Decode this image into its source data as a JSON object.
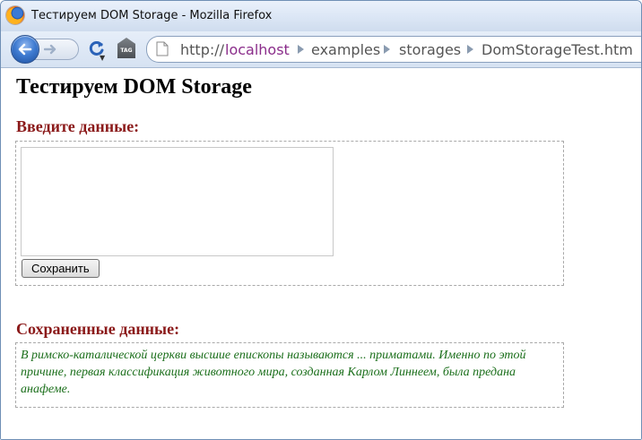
{
  "window": {
    "title": "Тестируем DOM Storage - Mozilla Firefox"
  },
  "navbar": {
    "url": {
      "scheme": "http://",
      "host": "localhost",
      "crumbs": [
        "examples",
        "storages",
        "DomStorageTest.htm"
      ]
    },
    "tag_icon_label": "TAG"
  },
  "page": {
    "heading": "Тестируем DOM Storage",
    "input_section": {
      "title": "Введите данные:",
      "textarea_value": "",
      "save_label": "Сохранить"
    },
    "saved_section": {
      "title": "Сохраненные данные:",
      "text": "В римско-каталической церкви высшие епископы называются ... приматами. Именно по этой причине, первая классификация животного мира, созданная Карлом Линнеем, была предана анафеме."
    }
  },
  "colors": {
    "section_title": "#8b1a1a",
    "saved_text": "#1a6e1a",
    "url_host": "#8b2e8b"
  }
}
